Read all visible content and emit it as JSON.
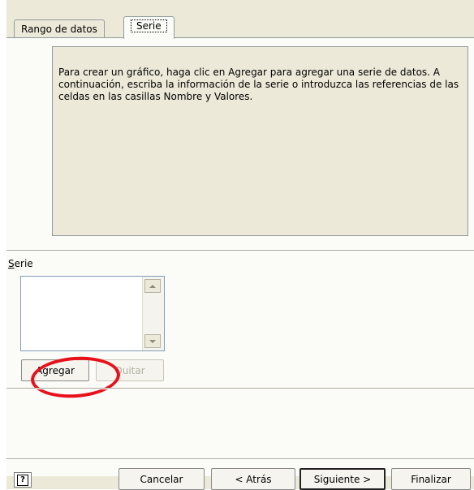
{
  "tabs": [
    {
      "label": "Rango de datos",
      "active": false
    },
    {
      "label": "Serie",
      "active": true
    }
  ],
  "info_text": "Para crear un gráfico, haga clic en Agregar para agregar una serie de datos. A continuación, escriba la información de la serie o introduzca las referencias de las celdas en las casillas Nombre y Valores.",
  "serie": {
    "label": "Serie",
    "accel": "S",
    "items": []
  },
  "buttons": {
    "add": {
      "label": "Agregar",
      "accel": "A",
      "enabled": true
    },
    "remove": {
      "label": "Quitar",
      "enabled": false
    }
  },
  "footer": {
    "help_icon": "help-icon",
    "cancel": "Cancelar",
    "back": "< Atrás",
    "next": "Siguiente >",
    "finish": "Finalizar"
  },
  "annotation_color": "#e8101a"
}
